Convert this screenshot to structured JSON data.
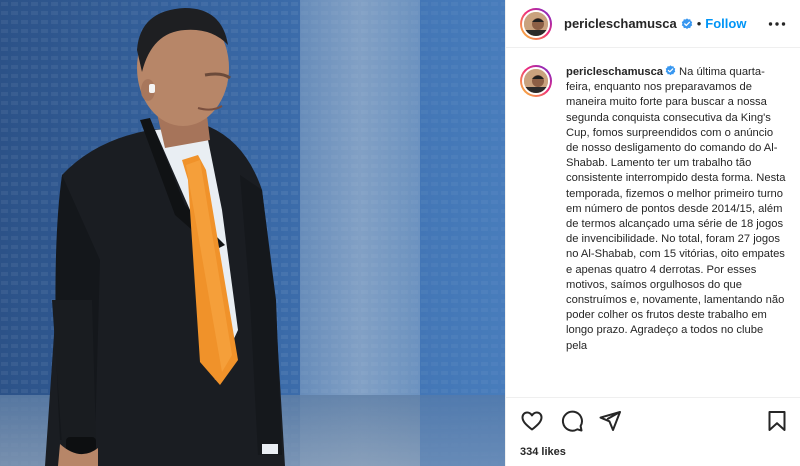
{
  "header": {
    "username": "pericleschamusca",
    "separator": "•",
    "follow_label": "Follow"
  },
  "caption": {
    "username": "pericleschamusca",
    "text": "Na última quarta-feira, enquanto nos preparavamos de maneira muito forte para buscar a nossa segunda conquista consecutiva da King's Cup, fomos surpreendidos com o anúncio de nosso desligamento do comando do Al-Shabab. Lamento ter um trabalho tão consistente interrompido desta forma. Nesta temporada, fizemos o melhor primeiro turno em número de pontos desde 2014/15, além de termos alcançado uma série de 18 jogos de invencibilidade. No total, foram 27 jogos no Al-Shabab, com 15 vitórias, oito empates e apenas quatro 4 derrotas. Por esses motivos, saímos orgulhosos do que construímos e, novamente, lamentando não poder colher os frutos deste trabalho em longo prazo. Agradeço a todos no clube pela"
  },
  "likes": "334 likes",
  "colors": {
    "follow": "#0095f6",
    "verified": "#3897f0",
    "border": "#efefef",
    "text": "#262626"
  },
  "icons": {
    "more": "more-options-icon",
    "like": "heart-icon",
    "comment": "comment-icon",
    "share": "share-icon",
    "save": "bookmark-icon",
    "verified": "verified-badge-icon"
  }
}
